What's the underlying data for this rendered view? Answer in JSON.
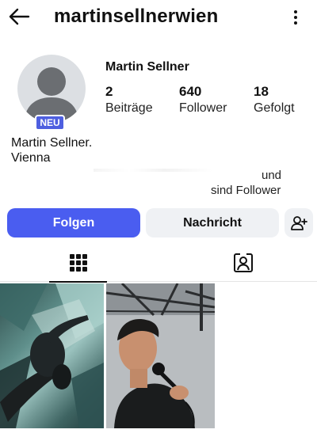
{
  "header": {
    "username": "martinsellnerwien",
    "back_icon": "arrow-left-icon",
    "more_icon": "more-vertical-icon"
  },
  "profile": {
    "full_name": "Martin Sellner",
    "badge": "NEU",
    "stats": [
      {
        "value": "2",
        "label": "Beiträge"
      },
      {
        "value": "640",
        "label": "Follower"
      },
      {
        "value": "18",
        "label": "Gefolgt"
      }
    ],
    "bio": [
      "Martin Sellner.",
      "Vienna"
    ],
    "mutual_followers": [
      "und",
      "sind Follower"
    ]
  },
  "actions": {
    "follow": "Folgen",
    "message": "Nachricht",
    "add_user_icon": "add-user-icon"
  },
  "tabs": [
    {
      "icon": "grid-icon",
      "active": true
    },
    {
      "icon": "tagged-icon",
      "active": false
    }
  ],
  "colors": {
    "primary": "#4a5df0",
    "badge": "#4e5fe0",
    "secondary_button": "#eff1f4"
  }
}
